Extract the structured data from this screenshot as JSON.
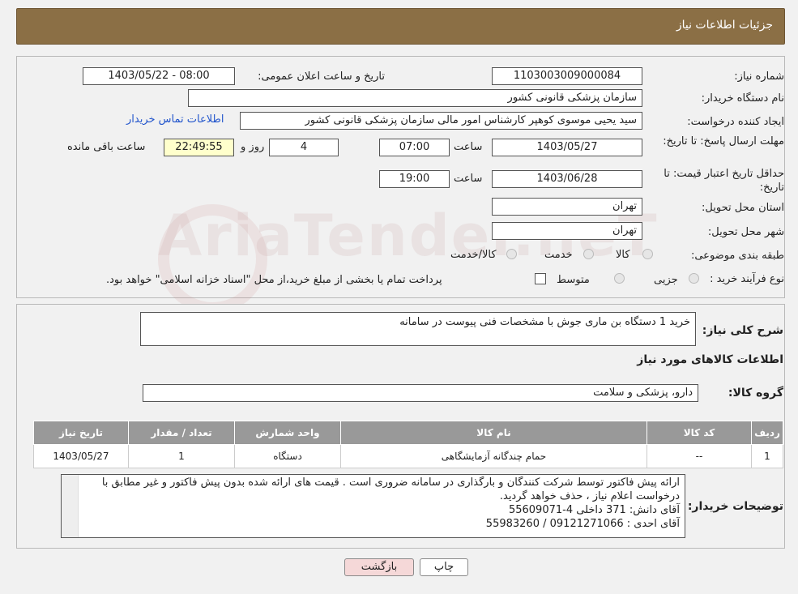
{
  "header": {
    "title": "جزئیات اطلاعات نیاز"
  },
  "form": {
    "need_number_label": "شماره نیاز:",
    "need_number": "1103003009000084",
    "announce_label": "تاریخ و ساعت اعلان عمومی:",
    "announce_value": "1403/05/22 - 08:00",
    "buyer_org_label": "نام دستگاه خریدار:",
    "buyer_org": "سازمان پزشکی قانونی کشور",
    "creator_label": "ایجاد کننده درخواست:",
    "creator": "سید یحیی موسوی کوهپر کارشناس امور مالی سازمان پزشکی قانونی کشور",
    "contact_link": "اطلاعات تماس خریدار",
    "deadline_label": "مهلت ارسال پاسخ: تا تاریخ:",
    "deadline_date": "1403/05/27",
    "time_label": "ساعت",
    "deadline_time": "07:00",
    "days": "4",
    "days_label": "روز و",
    "remaining_time": "22:49:55",
    "remaining_label": "ساعت باقی مانده",
    "validity_label": "حداقل تاریخ اعتبار قیمت: تا تاریخ:",
    "validity_date": "1403/06/28",
    "validity_time": "19:00",
    "province_label": "استان محل تحویل:",
    "province": "تهران",
    "city_label": "شهر محل تحویل:",
    "city": "تهران",
    "category_label": "طبقه بندی موضوعی:",
    "category_options": [
      "کالا",
      "خدمت",
      "کالا/خدمت"
    ],
    "process_label": "نوع فرآیند خرید :",
    "process_options": [
      "جزیی",
      "متوسط"
    ],
    "process_note": "پرداخت تمام یا بخشی از مبلغ خرید،از محل \"اسناد خزانه اسلامی\" خواهد بود."
  },
  "details": {
    "summary_label": "شرح کلی نیاز:",
    "summary": "خرید 1  دستگاه بن ماری جوش با مشخصات فنی پیوست در سامانه",
    "items_title": "اطلاعات کالاهای مورد نیاز",
    "group_label": "گروه کالا:",
    "group_value": "دارو، پزشکی و سلامت",
    "table": {
      "headers": [
        "ردیف",
        "کد کالا",
        "نام کالا",
        "واحد شمارش",
        "تعداد / مقدار",
        "تاریخ نیاز"
      ],
      "rows": [
        [
          "1",
          "--",
          "حمام چندگانه آزمایشگاهی",
          "دستگاه",
          "1",
          "1403/05/27"
        ]
      ]
    },
    "notes_label": "توضیحات خریدار:",
    "notes": "ارائه پیش فاکتور  توسط شرکت کنندگان و بارگذاری در سامانه ضروری است . قیمت های ارائه شده بدون پیش فاکتور  و غیر مطابق با درخواست اعلام نیاز  ، حذف خواهد گردید.\nآقای دانش:   371   داخلی        4-55609071\nآقای احدی  :  09121271066  /  55983260"
  },
  "buttons": {
    "print": "چاپ",
    "back": "بازگشت"
  },
  "watermark": "AriaTender.neT",
  "colors": {
    "header": "#8b6f45",
    "back_button": "#f5d8d8",
    "print_button": "#ffffff"
  }
}
